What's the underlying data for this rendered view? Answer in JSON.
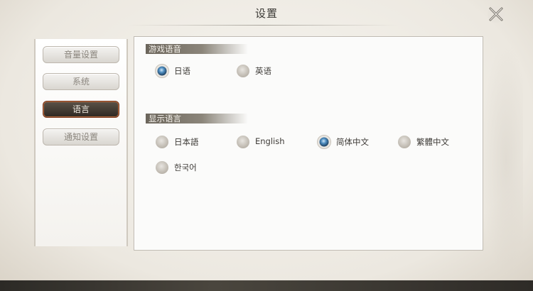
{
  "window": {
    "title": "设置"
  },
  "sidebar": {
    "items": [
      {
        "label": "音量设置",
        "active": false
      },
      {
        "label": "系统",
        "active": false
      },
      {
        "label": "语言",
        "active": true
      },
      {
        "label": "通知设置",
        "active": false
      }
    ]
  },
  "voice_language": {
    "heading": "游戏语音",
    "options": [
      {
        "label": "日语",
        "selected": true
      },
      {
        "label": "英语",
        "selected": false
      }
    ]
  },
  "display_language": {
    "heading": "显示语言",
    "options": [
      {
        "label": "日本語",
        "selected": false
      },
      {
        "label": "English",
        "selected": false
      },
      {
        "label": "简体中文",
        "selected": true
      },
      {
        "label": "繁體中文",
        "selected": false
      },
      {
        "label": "한국어",
        "selected": false
      }
    ]
  },
  "colors": {
    "active_tab": "#3a322b",
    "active_border": "#8a3f24",
    "selected_radio": "#4a7fb0"
  },
  "icons": {
    "close": "close-x-icon",
    "radio_on": "radio-selected-icon",
    "radio_off": "radio-unselected-icon"
  }
}
